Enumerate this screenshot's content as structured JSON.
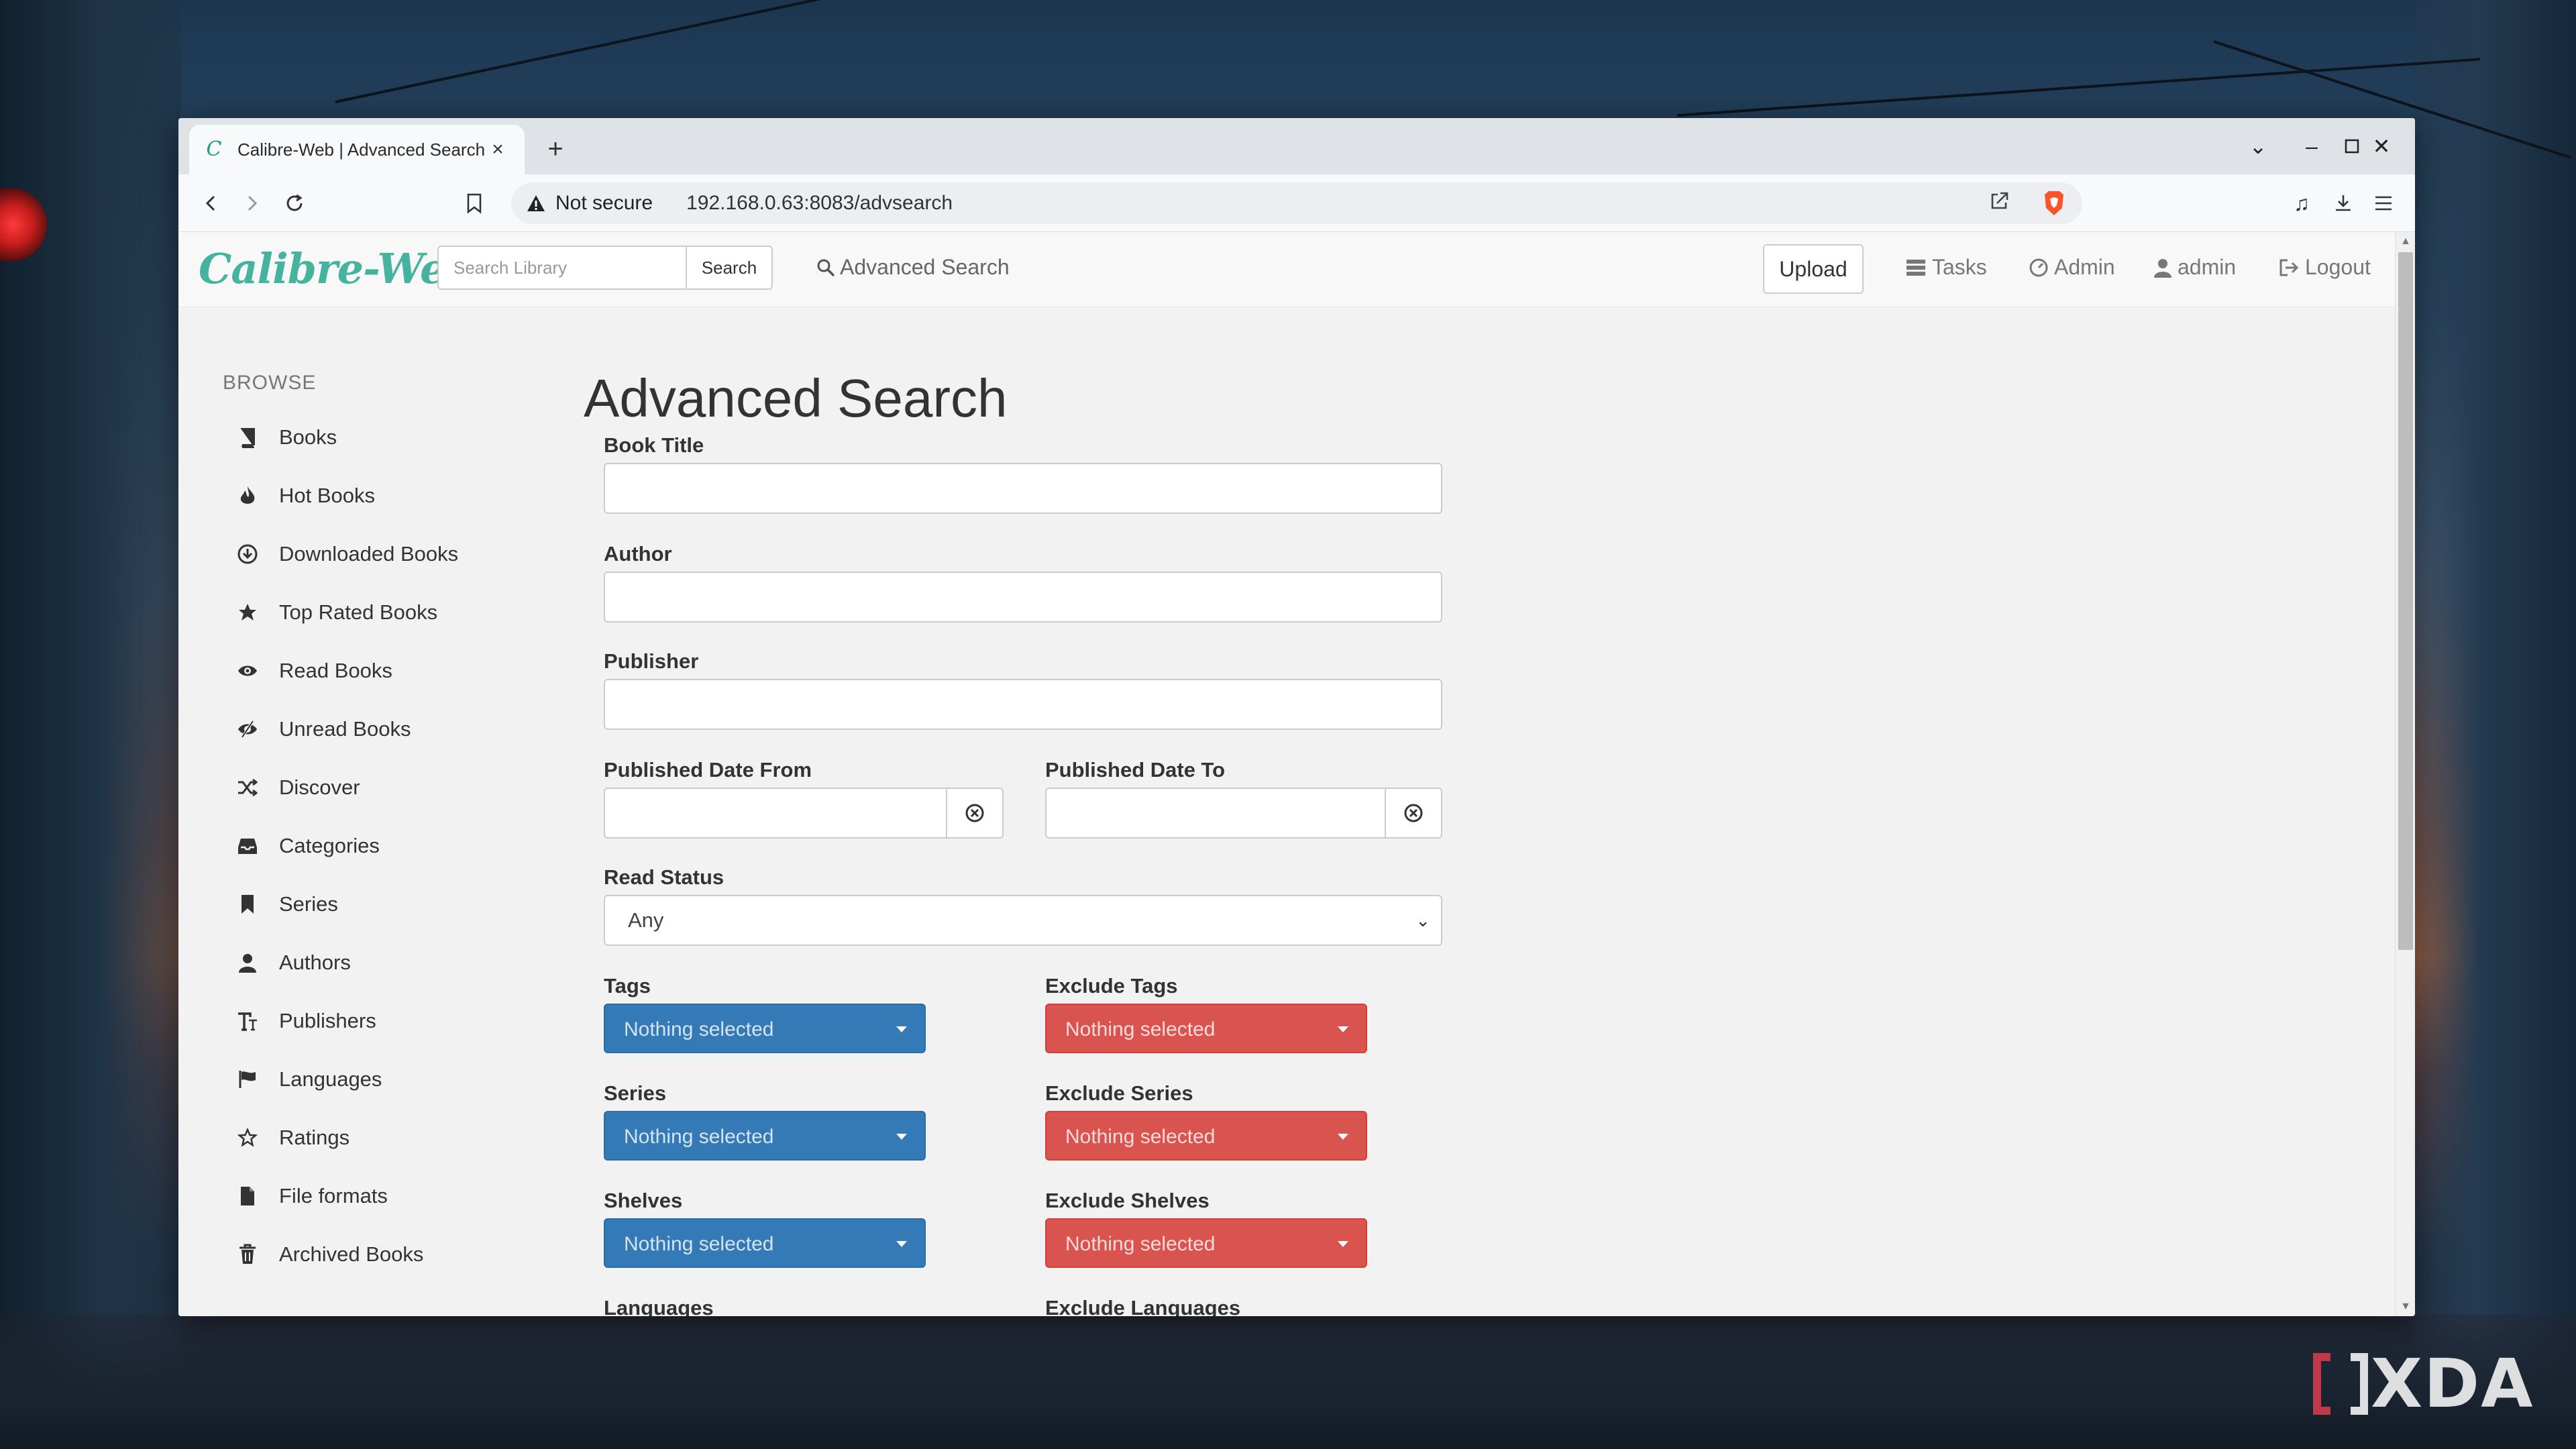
{
  "browser": {
    "tab_title": "Calibre-Web | Advanced Search",
    "new_tab_symbol": "+",
    "url_warning": "Not secure",
    "url": "192.168.0.63:8083/advsearch"
  },
  "navbar": {
    "brand": "Calibre-Web",
    "search_placeholder": "Search Library",
    "search_button": "Search",
    "advanced_search": "Advanced Search",
    "upload": "Upload",
    "tasks": "Tasks",
    "admin": "Admin",
    "user": "admin",
    "logout": "Logout"
  },
  "sidebar": {
    "heading": "BROWSE",
    "items": [
      {
        "label": "Books",
        "icon": "book-icon"
      },
      {
        "label": "Hot Books",
        "icon": "fire-icon"
      },
      {
        "label": "Downloaded Books",
        "icon": "download-icon"
      },
      {
        "label": "Top Rated Books",
        "icon": "star-icon"
      },
      {
        "label": "Read Books",
        "icon": "eye-open-icon"
      },
      {
        "label": "Unread Books",
        "icon": "eye-closed-icon"
      },
      {
        "label": "Discover",
        "icon": "shuffle-icon"
      },
      {
        "label": "Categories",
        "icon": "inbox-icon"
      },
      {
        "label": "Series",
        "icon": "bookmark-icon"
      },
      {
        "label": "Authors",
        "icon": "user-icon"
      },
      {
        "label": "Publishers",
        "icon": "text-size-icon"
      },
      {
        "label": "Languages",
        "icon": "flag-icon"
      },
      {
        "label": "Ratings",
        "icon": "star-empty-icon"
      },
      {
        "label": "File formats",
        "icon": "file-icon"
      },
      {
        "label": "Archived Books",
        "icon": "trash-icon"
      }
    ]
  },
  "form": {
    "title": "Advanced Search",
    "book_title_label": "Book Title",
    "author_label": "Author",
    "publisher_label": "Publisher",
    "date_from_label": "Published Date From",
    "date_to_label": "Published Date To",
    "read_status_label": "Read Status",
    "read_status_value": "Any",
    "tags_label": "Tags",
    "exclude_tags_label": "Exclude Tags",
    "series_label": "Series",
    "exclude_series_label": "Exclude Series",
    "shelves_label": "Shelves",
    "exclude_shelves_label": "Exclude Shelves",
    "languages_label": "Languages",
    "exclude_languages_label": "Exclude Languages",
    "nothing_selected": "Nothing selected"
  },
  "watermark": "XDA",
  "colors": {
    "brand": "#45b39d",
    "include_dropdown": "#337ab7",
    "exclude_dropdown": "#d9534f"
  }
}
